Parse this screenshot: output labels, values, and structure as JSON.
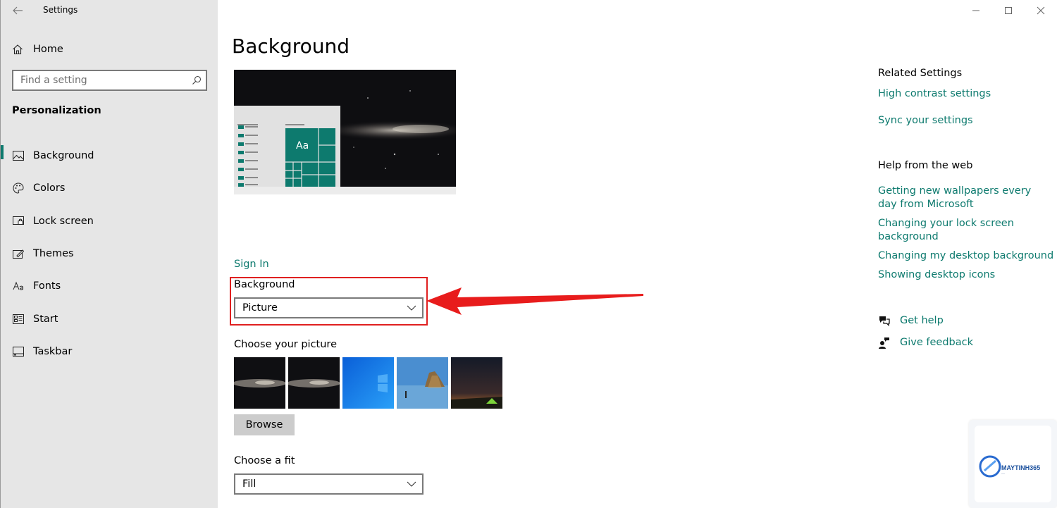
{
  "window": {
    "app_title": "Settings"
  },
  "sidebar": {
    "home_label": "Home",
    "search_placeholder": "Find a setting",
    "section_title": "Personalization",
    "items": [
      {
        "label": "Background",
        "icon": "picture-icon",
        "active": true
      },
      {
        "label": "Colors",
        "icon": "palette-icon",
        "active": false
      },
      {
        "label": "Lock screen",
        "icon": "lock-screen-icon",
        "active": false
      },
      {
        "label": "Themes",
        "icon": "themes-icon",
        "active": false
      },
      {
        "label": "Fonts",
        "icon": "fonts-icon",
        "active": false
      },
      {
        "label": "Start",
        "icon": "start-icon",
        "active": false
      },
      {
        "label": "Taskbar",
        "icon": "taskbar-icon",
        "active": false
      }
    ]
  },
  "main": {
    "title": "Background",
    "preview_tile_text": "Aa",
    "sign_in_link": "Sign In",
    "background_label": "Background",
    "background_value": "Picture",
    "choose_picture_label": "Choose your picture",
    "browse_label": "Browse",
    "fit_label": "Choose a fit",
    "fit_value": "Fill"
  },
  "related": {
    "heading": "Related Settings",
    "links": [
      "High contrast settings",
      "Sync your settings"
    ]
  },
  "help_web": {
    "heading": "Help from the web",
    "links": [
      "Getting new wallpapers every day from Microsoft",
      "Changing your lock screen background",
      "Changing my desktop background",
      "Showing desktop icons"
    ]
  },
  "support": {
    "get_help": "Get help",
    "give_feedback": "Give feedback"
  },
  "watermark": {
    "brand": "MAYTINH365"
  },
  "colors": {
    "accent": "#0d7a6e",
    "highlight": "#e02020",
    "sidebar_bg": "#e6e6e6"
  }
}
